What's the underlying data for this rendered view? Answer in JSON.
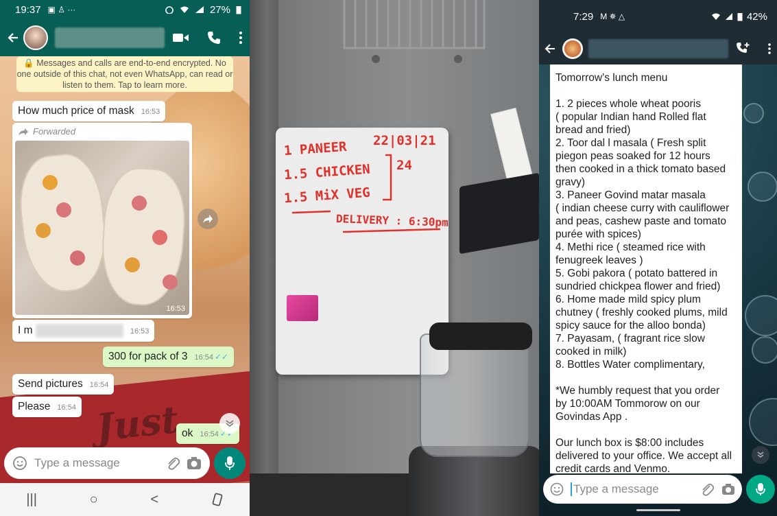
{
  "left_chat": {
    "status_bar": {
      "time": "19:37",
      "status_icons": "▣ ♙ ···",
      "battery": "27%"
    },
    "encryption_notice": "🔒 Messages and calls are end-to-end encrypted. No one outside of this chat, not even WhatsApp, can read or listen to them. Tap to learn more.",
    "messages": [
      {
        "text": "How much  price of mask",
        "time": "16:53",
        "direction": "in"
      },
      {
        "forwarded_label": "Forwarded",
        "time": "16:53",
        "direction": "in",
        "type": "image"
      },
      {
        "text": "I m",
        "time": "16:53",
        "direction": "in"
      },
      {
        "text": "300 for pack of 3",
        "time": "16:54",
        "direction": "out",
        "ticks": "✓✓"
      },
      {
        "text": "Send pictures",
        "time": "16:54",
        "direction": "in"
      },
      {
        "text": "Please",
        "time": "16:54",
        "direction": "in"
      },
      {
        "text": "ok",
        "time": "16:54",
        "direction": "out",
        "ticks": "✓✓"
      }
    ],
    "input_placeholder": "Type a message",
    "nav": {
      "recents": "|||",
      "home": "○",
      "back": "<"
    }
  },
  "whiteboard": {
    "lines": [
      "1 PANEER",
      "1.5 CHICKEN",
      "1.5 MiX VEG",
      "22|03|21",
      "24",
      "DELIVERY : 6:30pm"
    ]
  },
  "right_chat": {
    "status_bar": {
      "time": "7:29",
      "icons": "M ✵ △",
      "battery": "42%"
    },
    "menu_lines": [
      "Tomorrow’s  lunch menu",
      "",
      "1. 2 pieces whole wheat pooris",
      "( popular Indian hand Rolled flat",
      "bread and fried)",
      "2. Toor dal l masala ( Fresh split",
      "piegon peas soaked for 12 hours",
      "then cooked in a thick tomato based",
      "gravy)",
      "3. Paneer Govind matar masala",
      "( indian cheese curry with cauliflower",
      "and peas, cashew paste and tomato",
      "purée with spices)",
      "4. Methi rice ( steamed rice with",
      "fenugreek leaves )",
      "5. Gobi pakora ( potato battered in",
      "sundried chickpea flower and fried)",
      "6. Home made mild spicy plum",
      "chutney ( freshly cooked plums, mild",
      "spicy sauce for the alloo bonda)",
      "7. Payasam, ( fragrant rice slow",
      "cooked in milk)",
      "8. Bottles Water complimentary,",
      "",
      "*We humbly request that you order",
      "by 10:00AM Tommorow on our",
      "Govindas App .",
      "",
      "Our lunch box is $8:00 includes",
      "delivered to your office. We accept all",
      "credit cards and Venmo."
    ],
    "input_placeholder": "Type a message"
  },
  "colors": {
    "whatsapp_green": "#075e54",
    "bubble_out": "#dcf8c6",
    "marker_red": "#e0302a",
    "dark_header": "#1f2c33"
  }
}
